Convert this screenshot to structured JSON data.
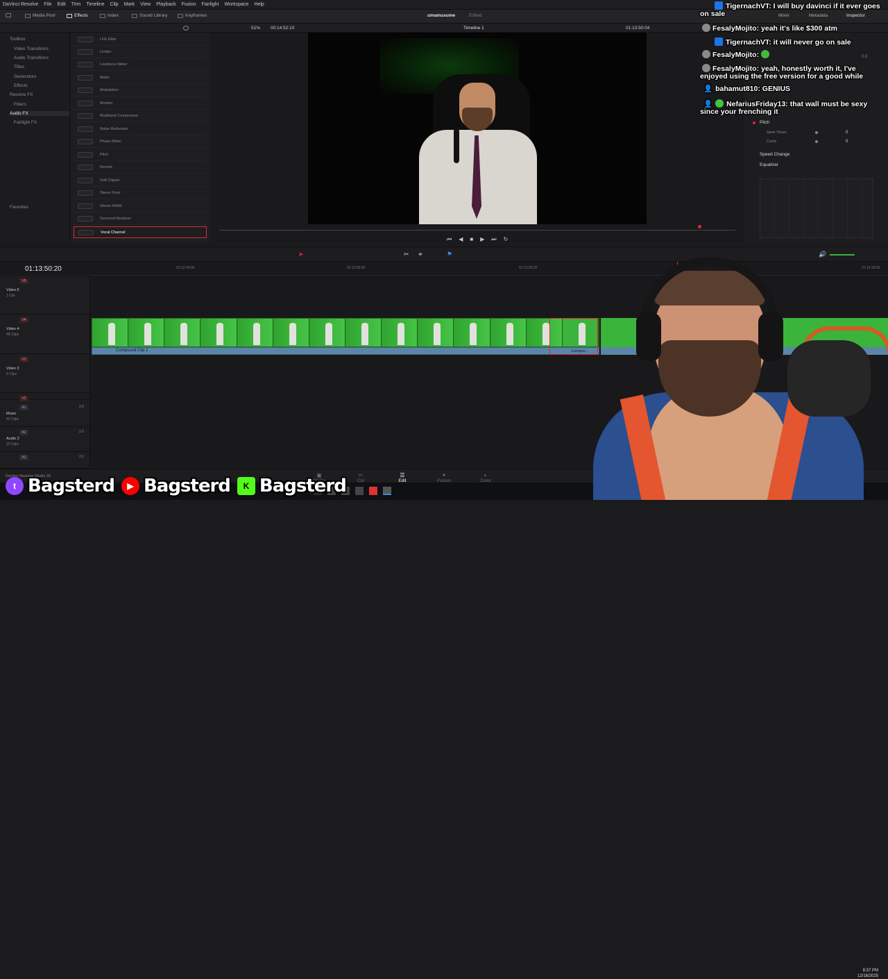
{
  "menubar": [
    "DaVinci Resolve",
    "File",
    "Edit",
    "Trim",
    "Timeline",
    "Clip",
    "Mark",
    "View",
    "Playback",
    "Fusion",
    "Fairlight",
    "Workspace",
    "Help"
  ],
  "toolbar": {
    "media_pool": "Media Pool",
    "effects": "Effects",
    "index": "Index",
    "sound_library": "Sound Library",
    "keyframes": "Keyframes",
    "project_name": "umamusume",
    "project_status": "Edited",
    "mixer": "Mixer",
    "metadata": "Metadata",
    "inspector": "Inspector"
  },
  "viewer": {
    "zoom": "51%",
    "source_tc": "00:14:52:10",
    "timeline_name": "Timeline 1",
    "record_tc": "01:13:50:04"
  },
  "effects_tree": [
    "Toolbox",
    "Video Transitions",
    "Audio Transitions",
    "Titles",
    "Generators",
    "Effects",
    "Resolve FX",
    "Filters",
    "Audio FX",
    "Fairlight FX",
    "Favorites"
  ],
  "effects_list": [
    "LFE Filter",
    "Limiter",
    "Loudness Meter",
    "Meter",
    "Modulation",
    "Monitor",
    "Multiband Compressor",
    "Noise Reduction",
    "Phase Meter",
    "Pitch",
    "Reverb",
    "Soft Clipper",
    "Stereo Fixer",
    "Stereo Width",
    "Surround Analyzer",
    "Vocal Channel"
  ],
  "inspector": {
    "pitch": "Pitch",
    "semi_tones": "Semi Tones",
    "semi_tones_val": "0",
    "cents": "Cents",
    "cents_val": "0",
    "speed_change": "Speed Change",
    "equalizer": "Equalizer",
    "volume_val": "0.0"
  },
  "chat": [
    {
      "user": "TigernachVT",
      "msg": "I will buy davinci if it ever goes",
      "cont": "on sale"
    },
    {
      "user": "FesalyMojito",
      "msg": "yeah it's like $300 atm"
    },
    {
      "user": "TigernachVT",
      "msg": "it will never go on sale"
    },
    {
      "user": "FesalyMojito",
      "msg": ""
    },
    {
      "user": "FesalyMojito",
      "msg": "yeah, honestly worth it, I've",
      "cont": "enjoyed using the free version for a good while"
    },
    {
      "user": "bahamut810",
      "msg": "GENIUS"
    },
    {
      "user": "NefariusFriday13",
      "msg": "that wall must be sexy",
      "cont": "since your frenching it"
    }
  ],
  "timeline": {
    "timecode": "01:13:50:20",
    "ruler": [
      "01:12:34:00",
      "01:13:00:00",
      "01:13:26:00",
      "01:14:18:00"
    ],
    "tracks": [
      {
        "id": "V5",
        "name": "Video 5",
        "count": "1 Clip"
      },
      {
        "id": "V4",
        "name": "Video 4",
        "count": "48 Clips"
      },
      {
        "id": "V3",
        "name": "Video 3",
        "count": "9 Clips"
      },
      {
        "id": "V2",
        "name": "",
        "count": ""
      },
      {
        "id": "A1",
        "name": "Music",
        "count": "42 Clips",
        "level": "2.0"
      },
      {
        "id": "A2",
        "name": "Audio 2",
        "count": "23 Clips",
        "level": "2.0"
      },
      {
        "id": "A3",
        "name": "",
        "count": "",
        "level": "2.0"
      }
    ],
    "clip1": "Compound Clip 2",
    "clip2": "Compou..."
  },
  "pages": [
    "Media",
    "Cut",
    "Edit",
    "Fusion",
    "Color"
  ],
  "app_version": "DaVinci Resolve Studio 20",
  "overlay": {
    "name1": "Bagsterd",
    "name2": "Bagsterd",
    "name3": "Bagsterd"
  },
  "clock": {
    "time": "8:37 PM",
    "date": "12/18/2025"
  },
  "colors": {
    "accent_red": "#e0283a",
    "clip_green": "#3bb43b",
    "clip_blue": "#5b86a8"
  }
}
